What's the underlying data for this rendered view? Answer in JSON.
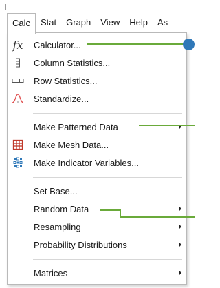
{
  "menubar": {
    "items": [
      "Calc",
      "Stat",
      "Graph",
      "View",
      "Help",
      "As"
    ],
    "active_index": 0
  },
  "calc_menu": {
    "items": [
      {
        "label": "Calculator...",
        "icon": "fx-icon",
        "submenu": false
      },
      {
        "label": "Column Statistics...",
        "icon": "column-icon",
        "submenu": false
      },
      {
        "label": "Row Statistics...",
        "icon": "row-icon",
        "submenu": false
      },
      {
        "label": "Standardize...",
        "icon": "standardize-icon",
        "submenu": false
      },
      {
        "label": "Make Patterned Data",
        "icon": "",
        "submenu": true
      },
      {
        "label": "Make Mesh Data...",
        "icon": "mesh-icon",
        "submenu": false
      },
      {
        "label": "Make Indicator Variables...",
        "icon": "indicator-icon",
        "submenu": false
      },
      {
        "label": "Set Base...",
        "icon": "",
        "submenu": false
      },
      {
        "label": "Random Data",
        "icon": "",
        "submenu": true
      },
      {
        "label": "Resampling",
        "icon": "",
        "submenu": true
      },
      {
        "label": "Probability Distributions",
        "icon": "",
        "submenu": true
      },
      {
        "label": "Matrices",
        "icon": "",
        "submenu": true
      }
    ]
  },
  "fx_symbol": "fx",
  "colors": {
    "callout_line": "#6aaa3a",
    "callout_dot": "#2f78b8",
    "standardize_icon": "#e05050",
    "mesh_icon": "#c0392b",
    "indicator_icon": "#2f78b8"
  }
}
